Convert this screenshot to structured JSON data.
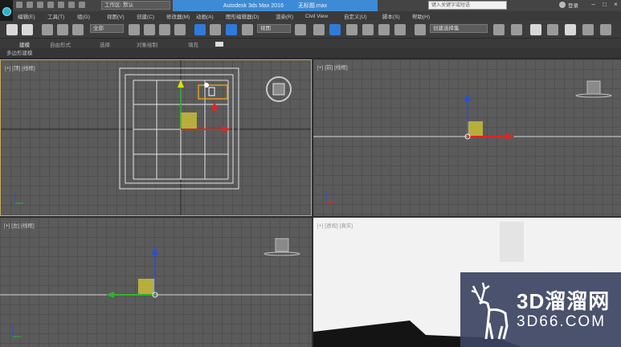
{
  "titlebar": {
    "workspace": "工作区: 默认",
    "app_title": "Autodesk 3ds Max 2016",
    "file_name": "无标题.max",
    "search_placeholder": "键入关键字或短语",
    "user_name": "登录",
    "min": "–",
    "max": "□",
    "close": "×"
  },
  "menu": [
    "编辑(E)",
    "工具(T)",
    "组(G)",
    "视图(V)",
    "创建(C)",
    "修改器(M)",
    "动画(A)",
    "图形编辑器(D)",
    "渲染(R)",
    "Civil View",
    "自定义(U)",
    "脚本(S)",
    "帮助(H)"
  ],
  "toolbar": {
    "filter": "全部",
    "coord": "视图",
    "selection_set": "创建选择集"
  },
  "ribbon": {
    "tabs": [
      "建模",
      "自由形式",
      "选择",
      "对象绘制",
      "填充"
    ],
    "subbar": "多边形建模"
  },
  "viewports": {
    "top": "[+] [顶] [线框]",
    "front": "[+] [前] [线框]",
    "left": "[+] [左] [线框]",
    "persp": "[+] [透视] [真实]"
  },
  "watermark": {
    "title": "3D溜溜网",
    "url": "3D66.COM"
  },
  "colors": {
    "accent": "#3d8bd6",
    "active_border": "#c8b062",
    "viewport_bg": "#5b5b5b",
    "axis_x": "#e02424",
    "axis_y": "#2fb32f",
    "axis_z": "#2a4fd6",
    "object": "#c8bd3a"
  }
}
